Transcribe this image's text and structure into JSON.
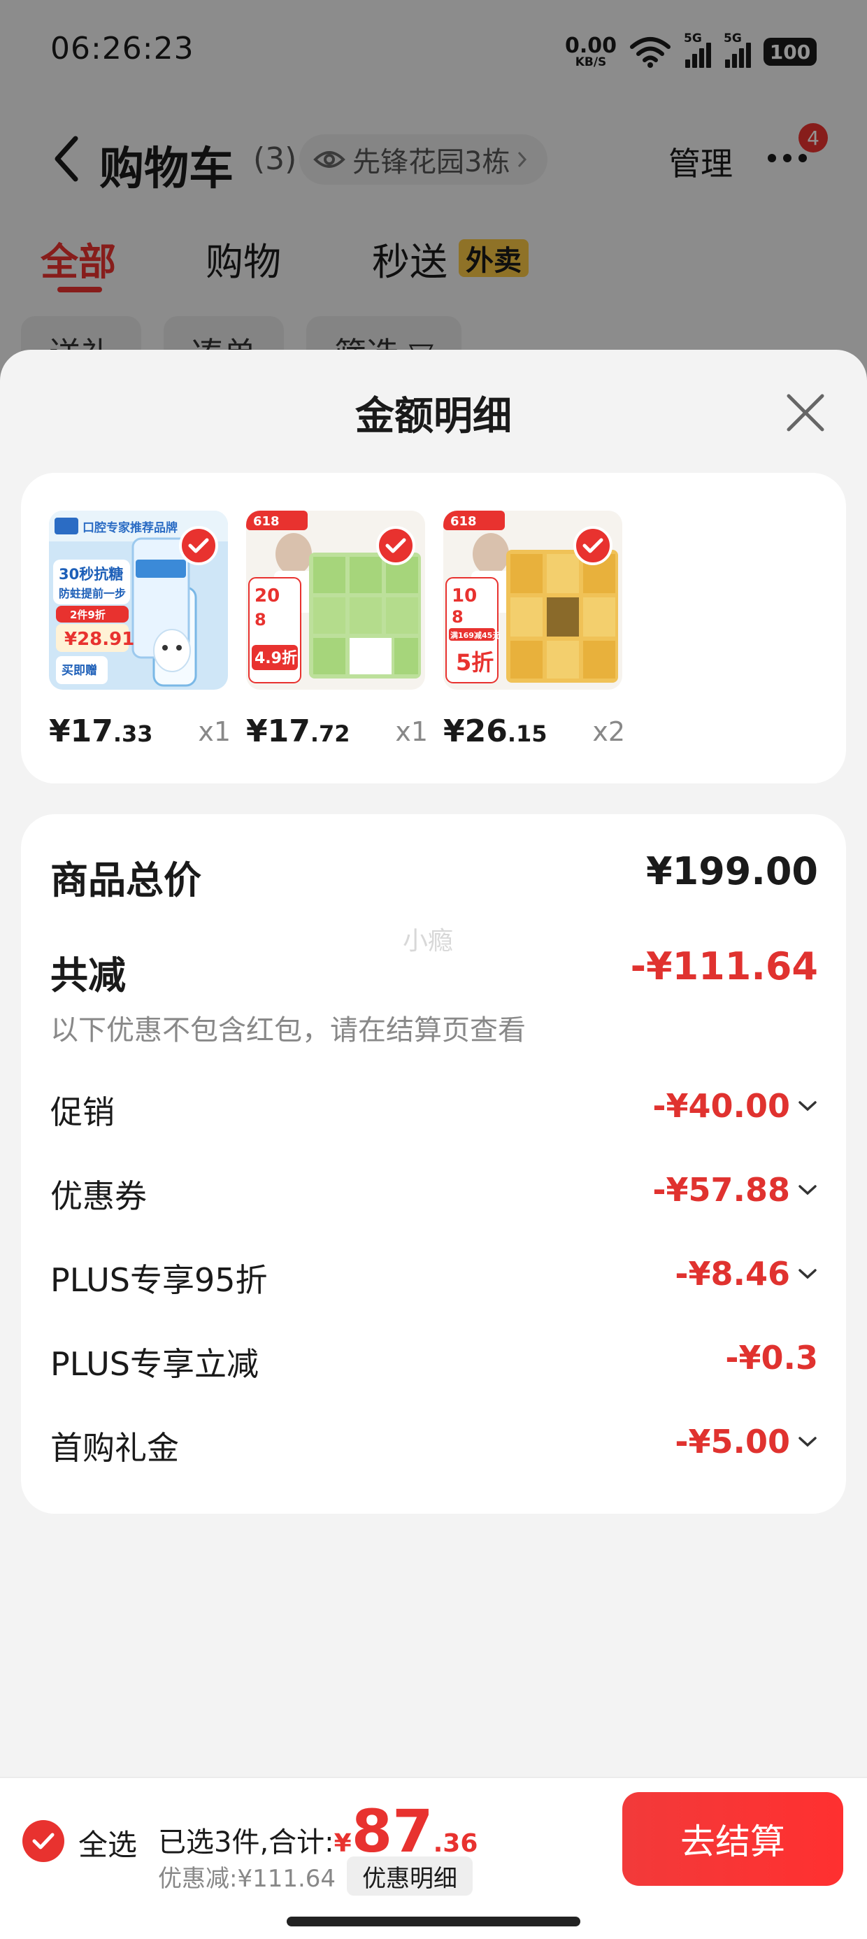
{
  "status_bar": {
    "time": "06:26:23",
    "net_speed_value": "0.00",
    "net_speed_unit": "KB/S",
    "sim1": "5G",
    "sim2": "5G",
    "battery": "100"
  },
  "nav": {
    "title": "购物车",
    "count": "(3)",
    "address": "先锋花园3栋",
    "manage": "管理",
    "badge": "4"
  },
  "tabs": [
    {
      "label": "全部"
    },
    {
      "label": "购物"
    },
    {
      "label": "秒送"
    }
  ],
  "waimai_badge": "外卖",
  "chips": [
    {
      "label": "送礼"
    },
    {
      "label": "凑单"
    },
    {
      "label": "筛选 ▽"
    }
  ],
  "sheet": {
    "title": "金额明细",
    "watermark": "小瘾",
    "products": [
      {
        "price_int": "¥17",
        "price_dec": ".33",
        "qty": "x1",
        "img_title": "30秒抗糖",
        "img_sub": "防蛀提前一步",
        "img_price": "¥28.91",
        "img_brand": "口腔专家推荐品牌",
        "img_gift": "买即赠",
        "img_promo": "2件9折"
      },
      {
        "price_int": "¥17",
        "price_dec": ".72",
        "qty": "x1",
        "img_tag": "618",
        "img_line1": "20",
        "img_line2": "8",
        "img_discount": "4.9折"
      },
      {
        "price_int": "¥26",
        "price_dec": ".15",
        "qty": "x2",
        "img_tag": "618",
        "img_line1": "10",
        "img_line2": "8",
        "img_promo": "满169减45元",
        "img_discount": "5折"
      }
    ],
    "summary": {
      "total_label": "商品总价",
      "total_value": "¥199.00",
      "reduce_label": "共减",
      "reduce_value": "-¥111.64",
      "note": "以下优惠不包含红包，请在结算页查看",
      "items": [
        {
          "label": "促销",
          "value": "-¥40.00"
        },
        {
          "label": "优惠券",
          "value": "-¥57.88"
        },
        {
          "label": "PLUS专享95折",
          "value": "-¥8.46"
        },
        {
          "label": "PLUS专享立减",
          "value": "-¥0.3"
        },
        {
          "label": "首购礼金",
          "value": "-¥5.00"
        }
      ]
    }
  },
  "bottom_bar": {
    "select_all": "全选",
    "selected_text": "已选3件,合计:",
    "currency": "¥",
    "total_int": "87",
    "total_dec": ".36",
    "discount_text": "优惠减:¥111.64",
    "detail_button": "优惠明细",
    "checkout": "去结算"
  },
  "colors": {
    "accent": "#e8322f",
    "waimai": "#f6c544"
  }
}
